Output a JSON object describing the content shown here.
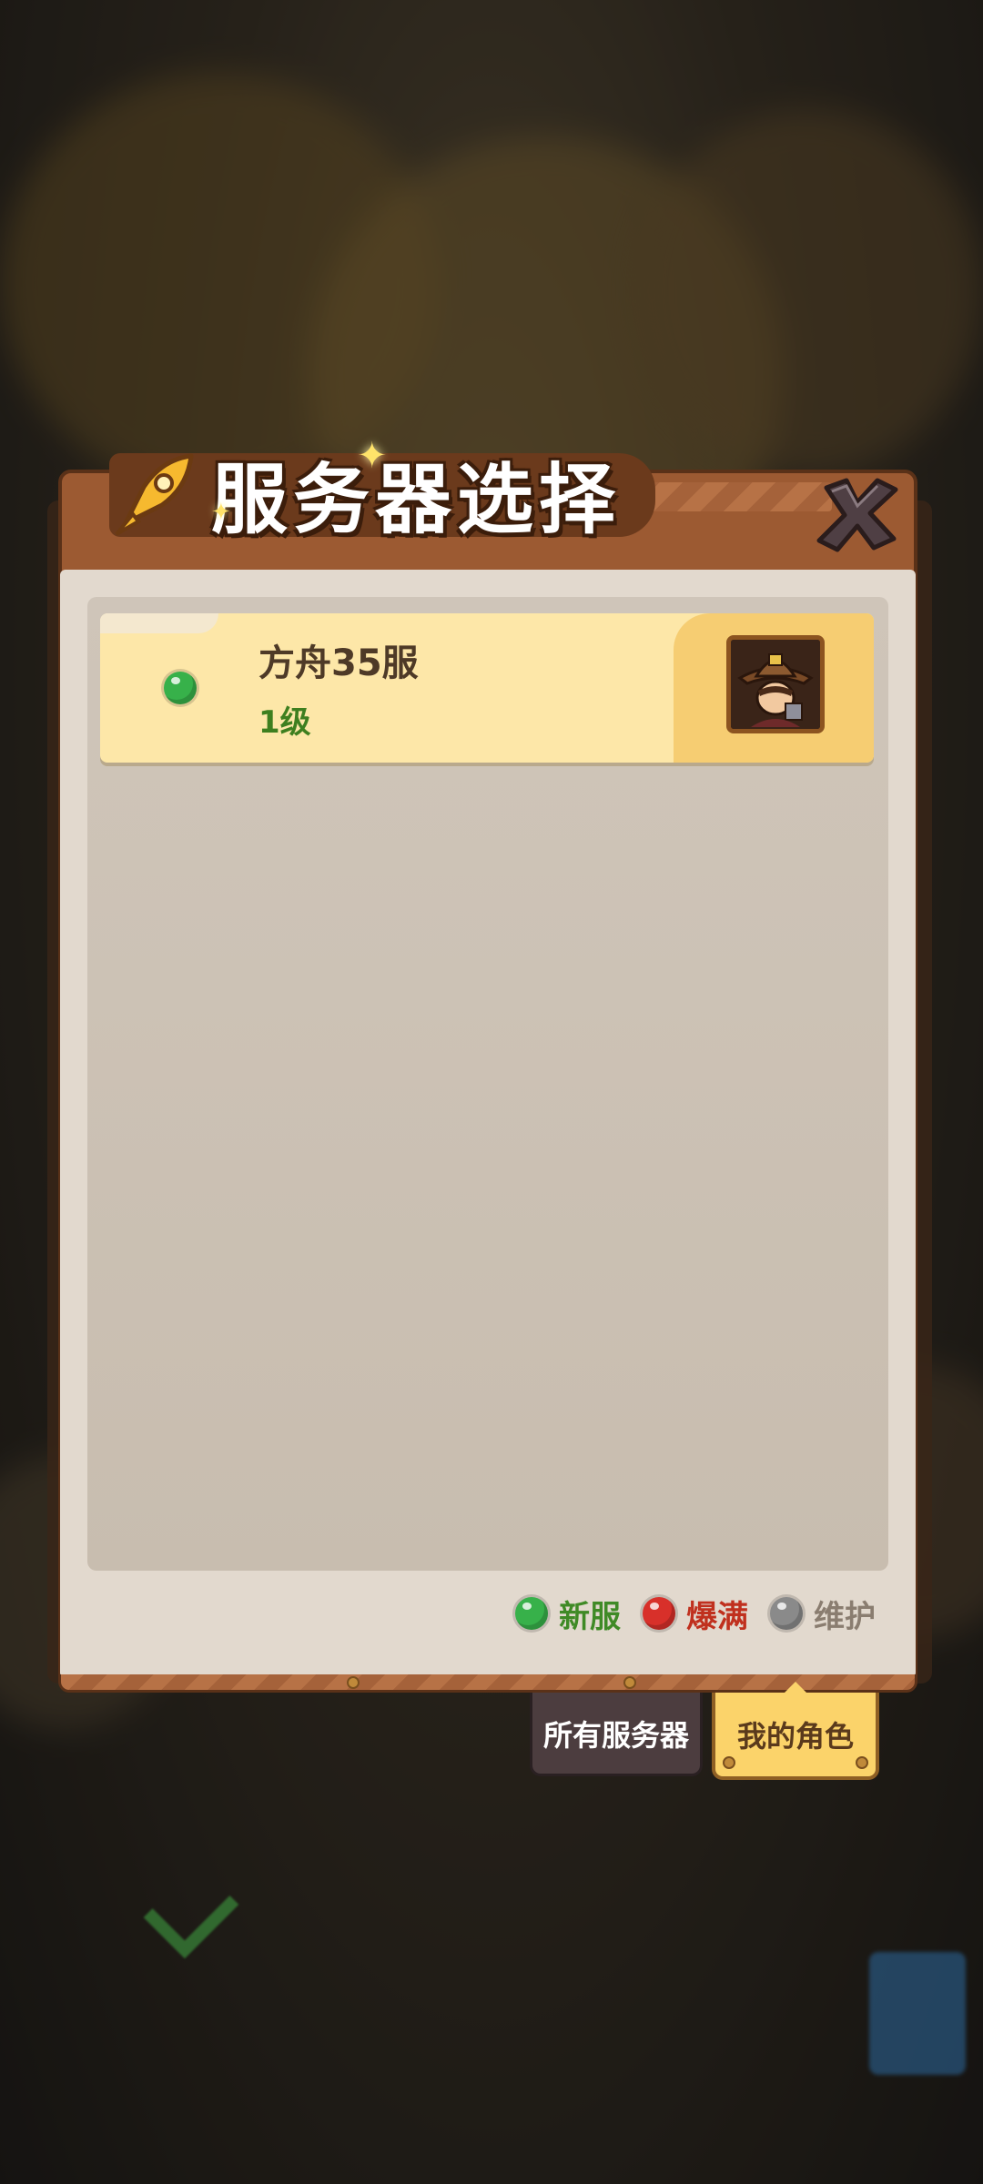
{
  "dialog": {
    "title": "服务器选择",
    "close_icon": "close-x-icon"
  },
  "servers": [
    {
      "name": "方舟35服",
      "level": "1级",
      "status": "new",
      "status_color": "#37b14a",
      "avatar_icon": "cowboy-hero-portrait-icon"
    }
  ],
  "legend": {
    "new_label": "新服",
    "full_label": "爆满",
    "maintenance_label": "维护",
    "colors": {
      "new": "#37b14a",
      "full": "#d8302a",
      "maintenance": "#8a8a8a"
    },
    "label_colors": {
      "new": "#3f8a26",
      "full": "#c0301e",
      "maintenance": "#8a7d70"
    }
  },
  "tabs": {
    "all_servers": "所有服务器",
    "my_roles": "我的角色",
    "active": "my_roles"
  }
}
